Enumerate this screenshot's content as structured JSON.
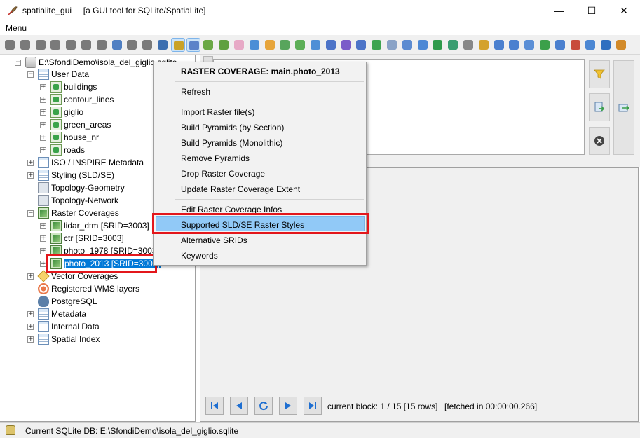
{
  "window": {
    "app_name": "spatialite_gui",
    "subtitle": "[a GUI tool for SQLite/SpatiaLite]",
    "minimize_glyph": "—",
    "maximize_glyph": "☐",
    "close_glyph": "✕"
  },
  "menubar": {
    "menu_label": "Menu"
  },
  "toolbar": {
    "button_count_note": "",
    "colors": [
      "#7a7a7a",
      "#7a7a7a",
      "#7a7a7a",
      "#7a7a7a",
      "#7a7a7a",
      "#7a7a7a",
      "#7a7a7a",
      "#4f7fc2",
      "#7a7a7a",
      "#7a7a7a",
      "#3d6fb0",
      "#c9a227",
      "#5b83c9",
      "#6aa845",
      "#5fa040",
      "#e7a9c6",
      "#4b8ed6",
      "#e7a53b",
      "#58a55c",
      "#5cae56",
      "#4e8fd6",
      "#4d74c8",
      "#7b5cc9",
      "#4d74c8",
      "#3da451",
      "#8aa3c7",
      "#5b8bd1",
      "#4c88d5",
      "#2e9a4b",
      "#3a9e71",
      "#888888",
      "#d4a22c",
      "#4b80cf",
      "#4b80cf",
      "#5b8fd6",
      "#3ba04a",
      "#4b80cf",
      "#c84b3c",
      "#4c87d3",
      "#2f6fc0",
      "#d28a2a"
    ],
    "icons": [
      "connect-icon",
      "disconnect-icon",
      "create-db-icon",
      "memory-db-icon",
      "memory-db-save-icon",
      "memory-db-load-icon",
      "memory-db-clone-icon",
      "vacuum-icon",
      "sql-script-icon",
      "load-shp-icon",
      "virtual-shp-icon",
      "raster-coverage-icon",
      "wms-icon",
      "charts-icon",
      "bug-icon",
      "eraser-icon",
      "import-icon",
      "export-icon",
      "globe-icon",
      "globe2-icon",
      "globe3-icon",
      "globe4-icon",
      "globe5-icon",
      "dbf-icon",
      "doc-icon",
      "xls-icon",
      "save-icon",
      "save-as-icon",
      "excel-icon",
      "csv-icon",
      "eye-icon",
      "attach-icon",
      "copy-icon",
      "clone-icon",
      "wifi-icon",
      "move-icon",
      "srid-icon",
      "pdf-icon",
      "help-icon",
      "about-icon",
      "exit-icon"
    ]
  },
  "tree": {
    "root": "E:\\SfondiDemo\\isola_del_giglio.sqlite",
    "user_data": "User Data",
    "tables": [
      "buildings",
      "contour_lines",
      "giglio",
      "green_areas",
      "house_nr",
      "roads"
    ],
    "iso_metadata": "ISO / INSPIRE Metadata",
    "styling": "Styling (SLD/SE)",
    "topology_geometry": "Topology-Geometry",
    "topology_network": "Topology-Network",
    "raster_coverages": "Raster Coverages",
    "rasters": [
      "lidar_dtm [SRID=3003]",
      "ctr [SRID=3003]",
      "photo_1978 [SRID=3003]",
      "photo_2013 [SRID=3003]"
    ],
    "vector_coverages": "Vector Coverages",
    "wms_layers": "Registered WMS layers",
    "postgresql": "PostgreSQL",
    "metadata": "Metadata",
    "internal_data": "Internal Data",
    "spatial_index": "Spatial Index"
  },
  "context_menu": {
    "header": "RASTER COVERAGE: main.photo_2013",
    "refresh": "Refresh",
    "import_raster": "Import Raster file(s)",
    "build_pyramids_section": "Build Pyramids (by Section)",
    "build_pyramids_mono": "Build Pyramids (Monolithic)",
    "remove_pyramids": "Remove Pyramids",
    "drop_coverage": "Drop Raster Coverage",
    "update_extent": "Update Raster Coverage Extent",
    "edit_infos": "Edit Raster Coverage Infos",
    "supported_styles": "Supported SLD/SE Raster Styles",
    "alternative_srids": "Alternative SRIDs",
    "keywords": "Keywords"
  },
  "results": {
    "current_block": "current block: 1 / 15 [15 rows]",
    "fetched": "[fetched in 00:00:00.266]"
  },
  "statusbar": {
    "text": "Current SQLite DB: E:\\SfondiDemo\\isola_del_giglio.sqlite"
  },
  "colors": {
    "selection": "#0078d7",
    "highlight_box": "#e3161b",
    "menu_hover": "#91c9f7"
  }
}
